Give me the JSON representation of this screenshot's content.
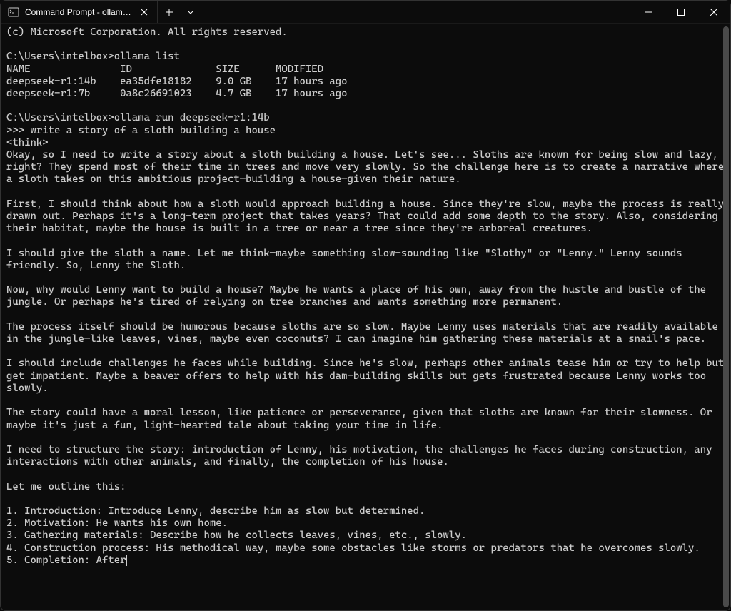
{
  "window": {
    "tab_title": "Command Prompt - ollama ru"
  },
  "terminal": {
    "copyright": "(c) Microsoft Corporation. All rights reserved.",
    "prompt1": "C:\\Users\\intelbox>ollama list",
    "header_name": "NAME",
    "header_id": "ID",
    "header_size": "SIZE",
    "header_modified": "MODIFIED",
    "row1_name": "deepseek-r1:14b",
    "row1_id": "ea35dfe18182",
    "row1_size": "9.0 GB",
    "row1_mod": "17 hours ago",
    "row2_name": "deepseek-r1:7b",
    "row2_id": "0a8c26691023",
    "row2_size": "4.7 GB",
    "row2_mod": "17 hours ago",
    "prompt2": "C:\\Users\\intelbox>ollama run deepseek-r1:14b",
    "user_prompt": ">>> write a story of a sloth building a house",
    "think_open": "<think>",
    "p1": "Okay, so I need to write a story about a sloth building a house. Let's see... Sloths are known for being slow and lazy, right? They spend most of their time in trees and move very slowly. So the challenge here is to create a narrative where a sloth takes on this ambitious project—building a house—given their nature.",
    "p2": "First, I should think about how a sloth would approach building a house. Since they're slow, maybe the process is really drawn out. Perhaps it's a long-term project that takes years? That could add some depth to the story. Also, considering their habitat, maybe the house is built in a tree or near a tree since they're arboreal creatures.",
    "p3": "I should give the sloth a name. Let me think—maybe something slow-sounding like \"Slothy\" or \"Lenny.\" Lenny sounds friendly. So, Lenny the Sloth.",
    "p4": "Now, why would Lenny want to build a house? Maybe he wants a place of his own, away from the hustle and bustle of the jungle. Or perhaps he's tired of relying on tree branches and wants something more permanent.",
    "p5": "The process itself should be humorous because sloths are so slow. Maybe Lenny uses materials that are readily available in the jungle—like leaves, vines, maybe even coconuts? I can imagine him gathering these materials at a snail's pace.",
    "p6": "I should include challenges he faces while building. Since he's slow, perhaps other animals tease him or try to help but get impatient. Maybe a beaver offers to help with his dam-building skills but gets frustrated because Lenny works too slowly.",
    "p7": "The story could have a moral lesson, like patience or perseverance, given that sloths are known for their slowness. Or maybe it's just a fun, light-hearted tale about taking your time in life.",
    "p8": "I need to structure the story: introduction of Lenny, his motivation, the challenges he faces during construction, any interactions with other animals, and finally, the completion of his house.",
    "outline_label": "Let me outline this:",
    "o1": "1. Introduction: Introduce Lenny, describe him as slow but determined.",
    "o2": "2. Motivation: He wants his own home.",
    "o3": "3. Gathering materials: Describe how he collects leaves, vines, etc., slowly.",
    "o4": "4. Construction process: His methodical way, maybe some obstacles like storms or predators that he overcomes slowly.",
    "o5": "5. Completion: After"
  }
}
